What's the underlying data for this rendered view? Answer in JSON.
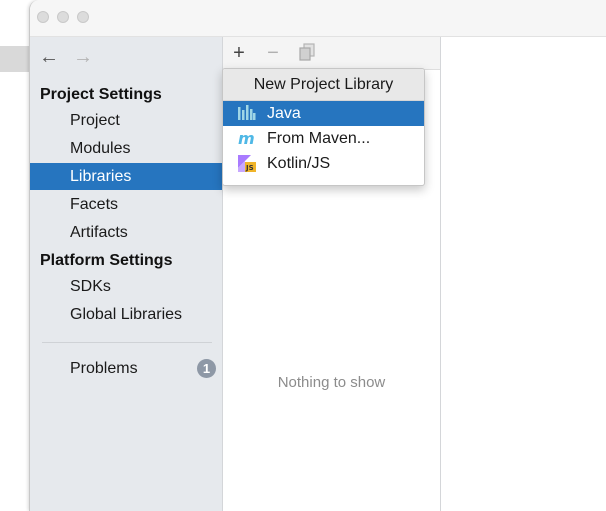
{
  "nav": {
    "back_icon": "arrow-left-icon",
    "forward_icon": "arrow-right-icon"
  },
  "sidebar": {
    "project_settings": {
      "title": "Project Settings",
      "items": [
        {
          "label": "Project"
        },
        {
          "label": "Modules"
        },
        {
          "label": "Libraries",
          "selected": true
        },
        {
          "label": "Facets"
        },
        {
          "label": "Artifacts"
        }
      ]
    },
    "platform_settings": {
      "title": "Platform Settings",
      "items": [
        {
          "label": "SDKs"
        },
        {
          "label": "Global Libraries"
        }
      ]
    },
    "problems": {
      "label": "Problems",
      "count": "1"
    }
  },
  "toolbar": {
    "add_icon": "plus-icon",
    "remove_icon": "minus-icon",
    "copy_icon": "copy-icon"
  },
  "libraries_panel": {
    "empty_text": "Nothing to show"
  },
  "popup": {
    "title": "New Project Library",
    "items": [
      {
        "label": "Java",
        "icon": "java-library-icon",
        "selected": true
      },
      {
        "label": "From Maven...",
        "icon": "maven-icon"
      },
      {
        "label": "Kotlin/JS",
        "icon": "kotlin-js-icon"
      }
    ]
  },
  "colors": {
    "selection": "#2675bf",
    "sidebar_bg": "#e6e9ed",
    "badge": "#8e98a6"
  }
}
